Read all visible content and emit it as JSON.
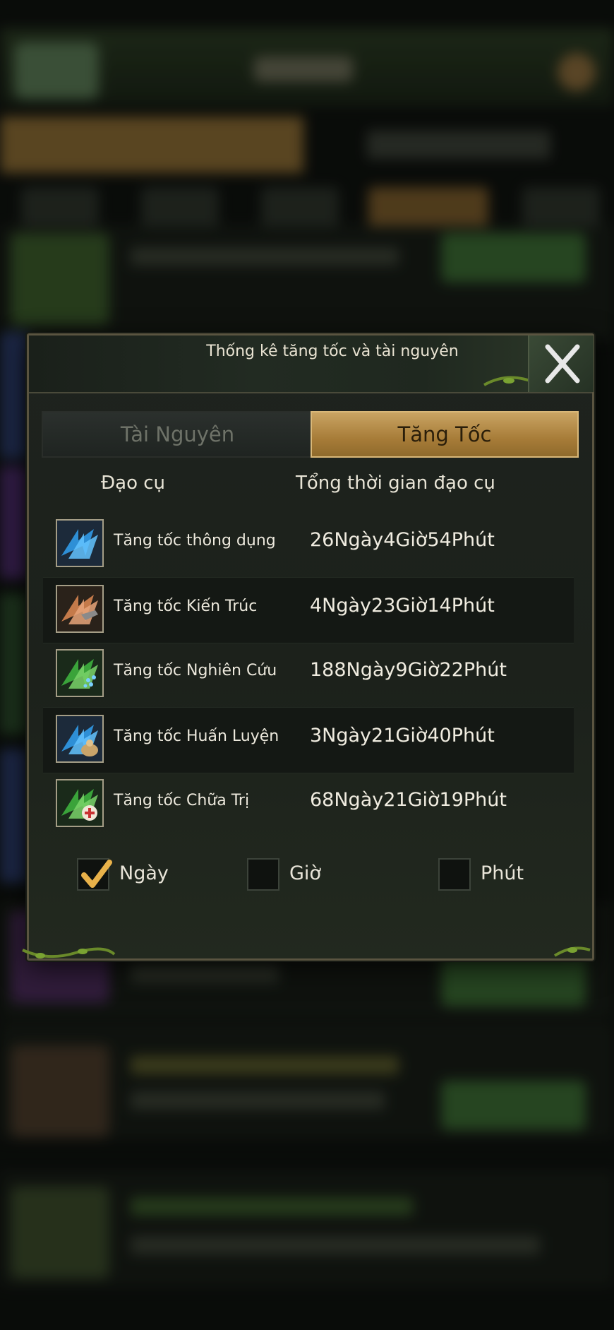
{
  "dialog": {
    "title": "Thống kê tăng tốc và tài nguyên",
    "close_icon": "close-x-icon"
  },
  "tabs": [
    {
      "label": "Tài Nguyên",
      "active": false
    },
    {
      "label": "Tăng Tốc",
      "active": true
    }
  ],
  "columns": {
    "item": "Đạo cụ",
    "total_time": "Tổng thời gian đạo cụ"
  },
  "rows": [
    {
      "name": "Tăng tốc thông dụng",
      "time": "26Ngày4Giờ54Phút",
      "icon": "speedup-general-icon"
    },
    {
      "name": "Tăng tốc Kiến Trúc",
      "time": "4Ngày23Giờ14Phút",
      "icon": "speedup-building-icon"
    },
    {
      "name": "Tăng tốc Nghiên Cứu",
      "time": "188Ngày9Giờ22Phút",
      "icon": "speedup-research-icon"
    },
    {
      "name": "Tăng tốc Huấn Luyện",
      "time": "3Ngày21Giờ40Phút",
      "icon": "speedup-training-icon"
    },
    {
      "name": "Tăng tốc Chữa Trị",
      "time": "68Ngày21Giờ19Phút",
      "icon": "speedup-healing-icon"
    }
  ],
  "units": [
    {
      "label": "Ngày",
      "checked": true
    },
    {
      "label": "Giờ",
      "checked": false
    },
    {
      "label": "Phút",
      "checked": false
    }
  ],
  "colors": {
    "accent_gold": "#b8893f",
    "panel_bg": "#1e231e",
    "text": "#ece8dc"
  }
}
